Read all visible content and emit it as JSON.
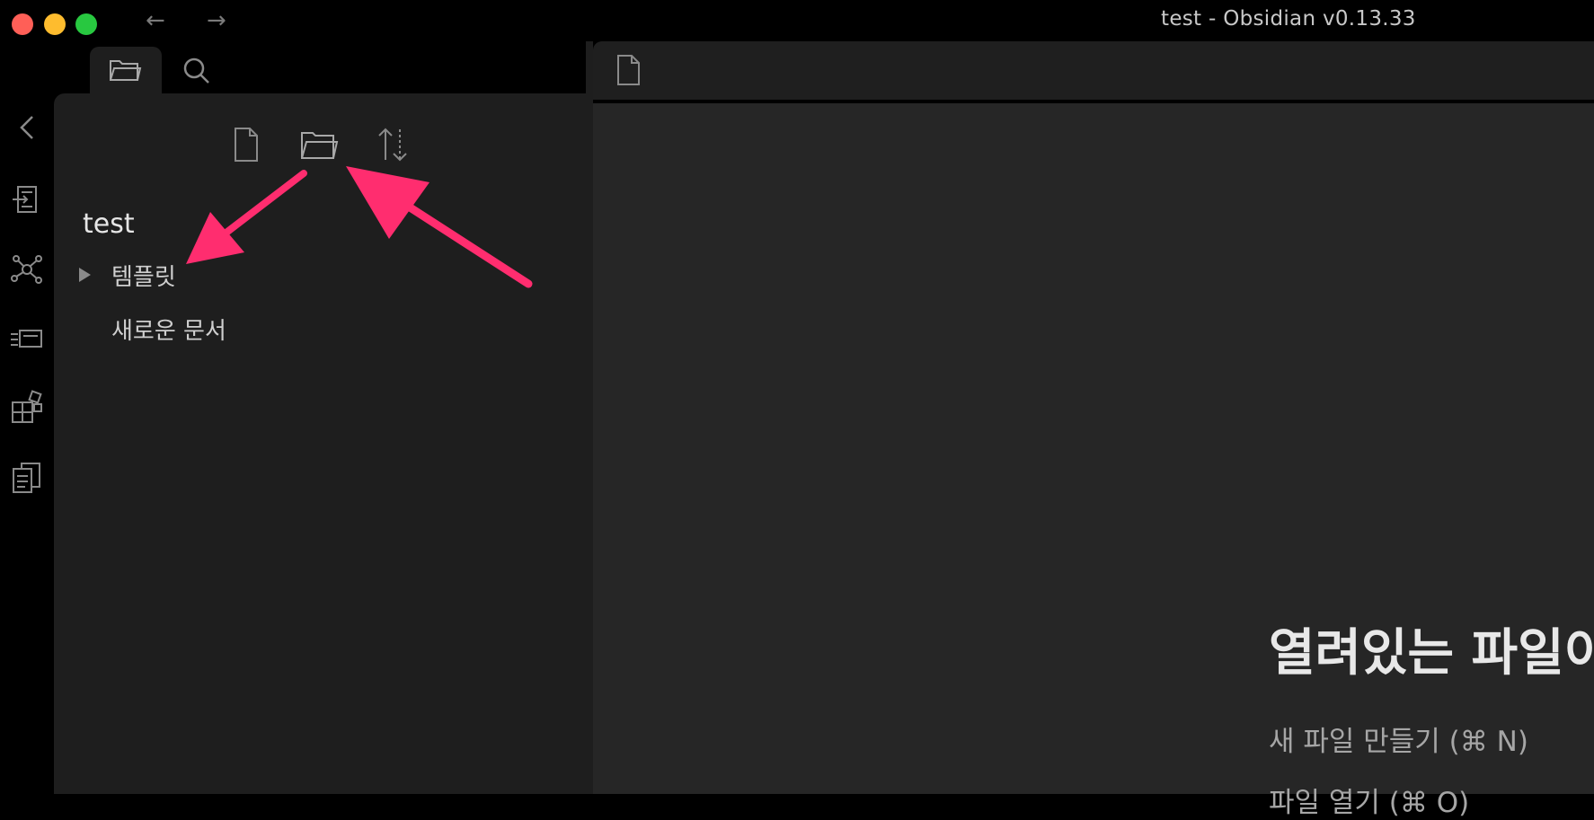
{
  "window": {
    "title": "test - Obsidian v0.13.33"
  },
  "traffic_lights": {
    "close_color": "#ff5f57",
    "minimize_color": "#febc2e",
    "zoom_color": "#28c840"
  },
  "nav": {
    "back_glyph": "←",
    "forward_glyph": "→"
  },
  "sidebar_tabs": [
    {
      "icon": "folder-icon",
      "active": true
    },
    {
      "icon": "search-icon",
      "active": false
    }
  ],
  "ribbon": {
    "collapse_icon": "chevron-left-icon",
    "icons": [
      "switcher-icon",
      "graph-icon",
      "stack-icon",
      "plugins-icon",
      "templates-icon"
    ]
  },
  "file_explorer": {
    "toolbar": [
      "new-note-icon",
      "new-folder-icon",
      "sort-icon"
    ],
    "vault_name": "test",
    "items": [
      {
        "type": "folder",
        "label": "템플릿",
        "collapsed": true
      },
      {
        "type": "file",
        "label": "새로운 문서"
      }
    ]
  },
  "editor": {
    "tab_icon": "document-icon",
    "empty_title": "열려있는 파일이",
    "actions": [
      "새 파일 만들기 (⌘ N)",
      "파일 열기 (⌘ O)"
    ]
  },
  "annotations": {
    "arrow_color": "#ff2d6f"
  }
}
